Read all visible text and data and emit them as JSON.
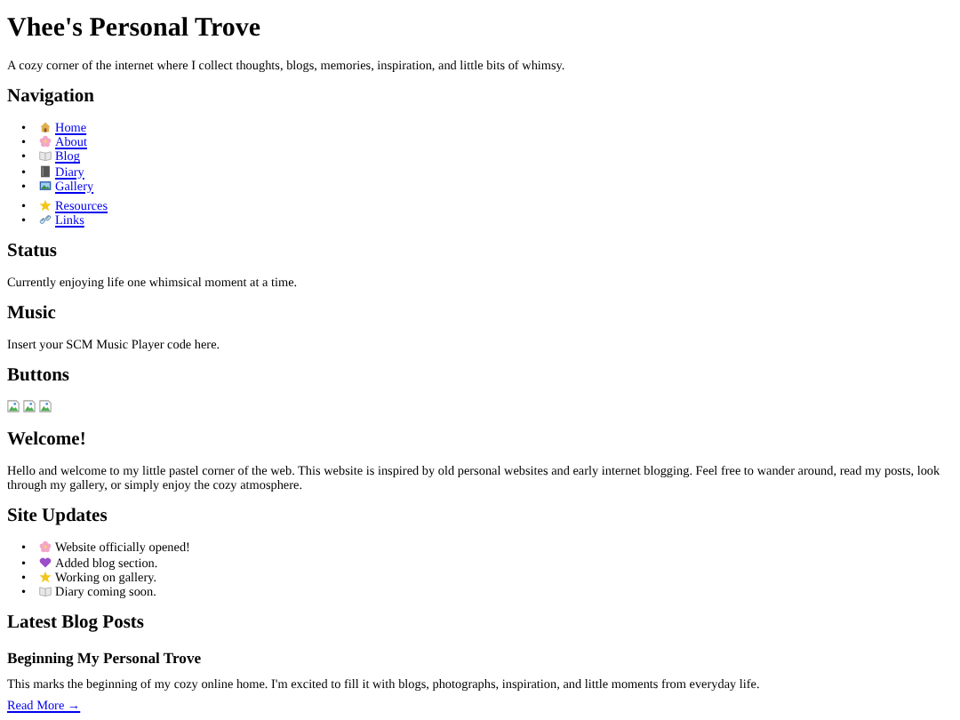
{
  "title": "Vhee's Personal Trove",
  "tagline": "A cozy corner of the internet where I collect thoughts, blogs, memories, inspiration, and little bits of whimsy.",
  "navigation": {
    "heading": "Navigation",
    "groups": [
      [
        {
          "marker": "•",
          "label": "Home"
        },
        {
          "marker": "•",
          "label": "About"
        },
        {
          "marker": "•",
          "label": "Blog"
        },
        {
          "marker": "•",
          "label": "Diary"
        },
        {
          "marker": "•",
          "label": "Gallery"
        }
      ],
      [
        {
          "marker": "•",
          "label": "Resources"
        },
        {
          "marker": "•",
          "label": "Links"
        }
      ]
    ]
  },
  "status": {
    "heading": "Status",
    "text": "Currently enjoying life one whimsical moment at a time."
  },
  "music": {
    "heading": "Music",
    "text": "Insert your SCM Music Player code here."
  },
  "buttons": {
    "heading": "Buttons",
    "images": [
      {
        "kind": "broken-image"
      },
      {
        "kind": "broken-image"
      },
      {
        "kind": "broken-image"
      }
    ]
  },
  "welcome": {
    "heading": "Welcome!",
    "text": "Hello and welcome to my little pastel corner of the web. This website is inspired by old personal websites and early internet blogging. Feel free to wander around, read my posts, look through my gallery, or simply enjoy the cozy atmosphere."
  },
  "updates": {
    "heading": "Site Updates",
    "items": [
      {
        "marker": "•",
        "text": "Website officially opened!"
      },
      {
        "marker": "•",
        "text": "Added blog section."
      },
      {
        "marker": "•",
        "text": "Working on gallery."
      },
      {
        "marker": "•",
        "text": "Diary coming soon."
      }
    ]
  },
  "blog": {
    "heading": "Latest Blog Posts",
    "posts": [
      {
        "title": "Beginning My Personal Trove",
        "excerpt": "This marks the beginning of my cozy online home. I'm excited to fill it with blogs, photographs, inspiration, and little moments from everyday life.",
        "link": "Read More →"
      }
    ]
  }
}
